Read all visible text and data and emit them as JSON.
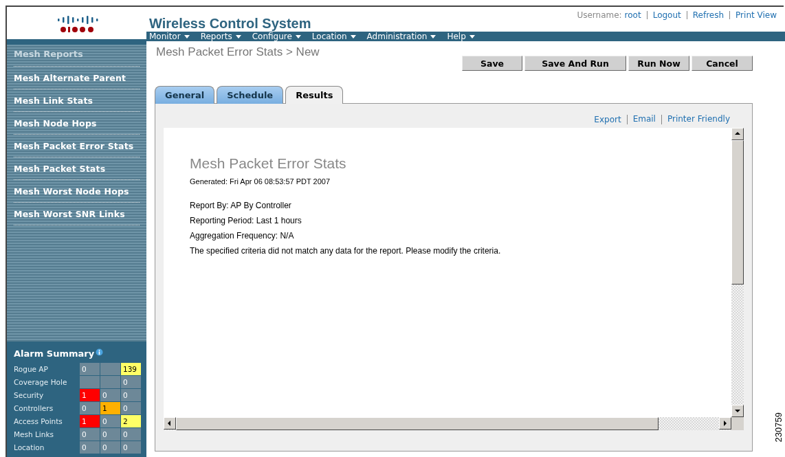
{
  "header": {
    "title": "Wireless Control System",
    "username_label": "Username:",
    "username": "root",
    "links": [
      "Logout",
      "Refresh",
      "Print View"
    ]
  },
  "nav": [
    "Monitor",
    "Reports",
    "Configure",
    "Location",
    "Administration",
    "Help"
  ],
  "sidebar": {
    "heading": "Mesh Reports",
    "items": [
      "Mesh Alternate Parent",
      "Mesh Link Stats",
      "Mesh Node Hops",
      "Mesh Packet Error Stats",
      "Mesh Packet Stats",
      "Mesh Worst Node Hops",
      "Mesh Worst SNR Links"
    ]
  },
  "alarm_summary": {
    "title": "Alarm Summary",
    "rows": [
      {
        "label": "Rogue AP",
        "cells": [
          {
            "text": "0",
            "color": "#6d8898"
          },
          {
            "color": "#6d8898"
          },
          {
            "text": "139",
            "color": "#ffff66"
          }
        ]
      },
      {
        "label": "Coverage Hole",
        "cells": [
          {
            "color": "#6d8898"
          },
          {
            "color": "#6d8898"
          },
          {
            "text": "0",
            "color": "#6d8898"
          }
        ]
      },
      {
        "label": "Security",
        "cells": [
          {
            "text": "1",
            "color": "#ff0000"
          },
          {
            "text": "0",
            "color": "#6d8898"
          },
          {
            "text": "0",
            "color": "#6d8898"
          }
        ]
      },
      {
        "label": "Controllers",
        "cells": [
          {
            "text": "0",
            "color": "#6d8898"
          },
          {
            "text": "1",
            "color": "#ffb000"
          },
          {
            "text": "0",
            "color": "#6d8898"
          }
        ]
      },
      {
        "label": "Access Points",
        "cells": [
          {
            "text": "1",
            "color": "#ff0000"
          },
          {
            "text": "0",
            "color": "#6d8898"
          },
          {
            "text": "2",
            "color": "#ffff66"
          }
        ]
      },
      {
        "label": "Mesh Links",
        "cells": [
          {
            "text": "0",
            "color": "#6d8898"
          },
          {
            "text": "0",
            "color": "#6d8898"
          },
          {
            "text": "0",
            "color": "#6d8898"
          }
        ]
      },
      {
        "label": "Location",
        "cells": [
          {
            "text": "0",
            "color": "#6d8898"
          },
          {
            "text": "0",
            "color": "#6d8898"
          },
          {
            "text": "0",
            "color": "#6d8898"
          }
        ]
      }
    ]
  },
  "page_title": "Mesh Packet Error Stats > New",
  "buttons": [
    "Save",
    "Save And Run",
    "Run Now",
    "Cancel"
  ],
  "tabs": [
    {
      "label": "General",
      "selected": false
    },
    {
      "label": "Schedule",
      "selected": false
    },
    {
      "label": "Results",
      "selected": true
    }
  ],
  "result_links": [
    "Export",
    "Email",
    "Printer Friendly"
  ],
  "report": {
    "title": "Mesh Packet Error Stats",
    "generated": "Generated: Fri Apr 06 08:53:57 PDT 2007",
    "lines": [
      "Report By: AP By Controller",
      "Reporting Period: Last 1 hours",
      "Aggregation Frequency: N/A",
      "The specified criteria did not match any data for the report. Please modify the criteria."
    ]
  },
  "figure_number": "230759"
}
